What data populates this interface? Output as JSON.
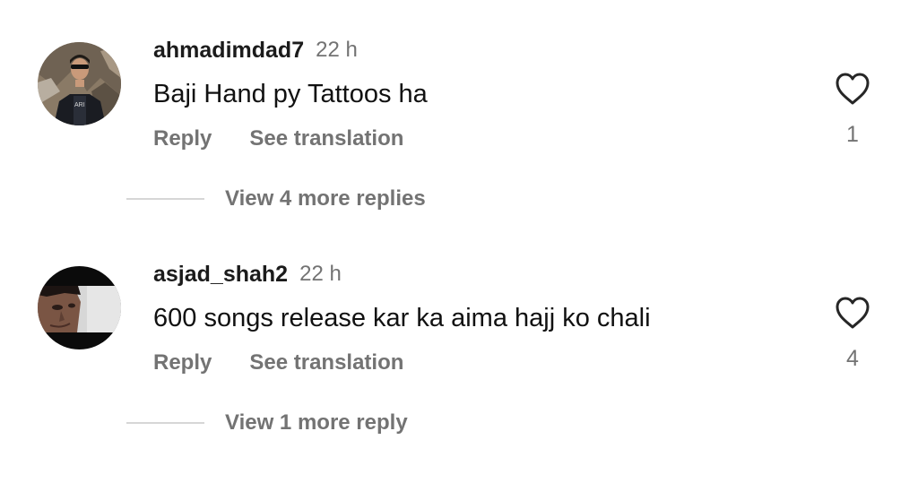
{
  "comments": [
    {
      "username": "ahmadimdad7",
      "time": "22 h",
      "text": "Baji Hand py Tattoos ha",
      "reply_label": "Reply",
      "translate_label": "See translation",
      "like_count": "1",
      "view_replies_label": "View 4 more replies",
      "avatar_icon": "profile-photo-avatar",
      "like_icon": "heart-outline-icon"
    },
    {
      "username": "asjad_shah2",
      "time": "22 h",
      "text": "600 songs release kar ka aima hajj ko chali",
      "reply_label": "Reply",
      "translate_label": "See translation",
      "like_count": "4",
      "view_replies_label": "View 1 more reply",
      "avatar_icon": "profile-photo-avatar",
      "like_icon": "heart-outline-icon"
    }
  ],
  "colors": {
    "username": "#1b1b1b",
    "text": "#111111",
    "secondary": "#737373",
    "divider": "#d6d6d6"
  }
}
